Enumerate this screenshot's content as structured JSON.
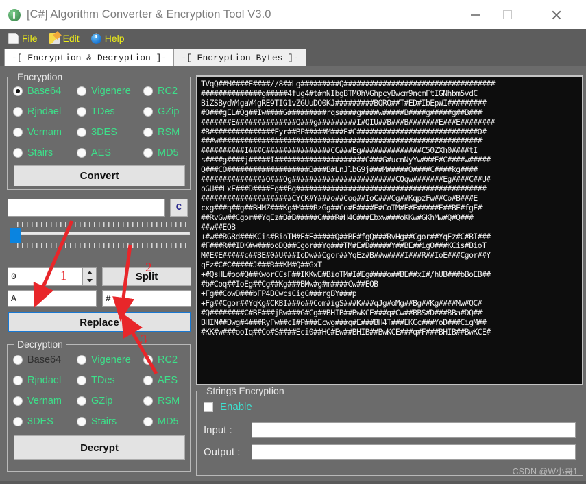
{
  "window": {
    "title": "[C#] Algorithm Converter & Encryption Tool V3.0",
    "app_icon": "app-logo-icon",
    "minimize_label": "–",
    "maximize_label": "□",
    "close_label": "✕"
  },
  "menu": {
    "items": [
      {
        "label": "File",
        "icon": "file-icon"
      },
      {
        "label": "Edit",
        "icon": "pencil-icon"
      },
      {
        "label": "Help",
        "icon": "info-icon"
      }
    ]
  },
  "tabs": [
    {
      "label": "-[ Encryption & Decryption ]-",
      "active": true
    },
    {
      "label": "-[ Encryption Bytes ]-",
      "active": false
    }
  ],
  "encryption": {
    "group_title": "Encryption",
    "options": [
      {
        "label": "Base64",
        "checked": true
      },
      {
        "label": "Vigenere",
        "checked": false
      },
      {
        "label": "RC2",
        "checked": false
      },
      {
        "label": "Rjndael",
        "checked": false
      },
      {
        "label": "TDes",
        "checked": false
      },
      {
        "label": "GZip",
        "checked": false
      },
      {
        "label": "Vernam",
        "checked": false
      },
      {
        "label": "3DES",
        "checked": false
      },
      {
        "label": "RSM",
        "checked": false
      },
      {
        "label": "Stairs",
        "checked": false
      },
      {
        "label": "AES",
        "checked": false
      },
      {
        "label": "MD5",
        "checked": false
      }
    ],
    "convert_label": "Convert"
  },
  "middle": {
    "key_input_value": "",
    "key_input_placeholder": "",
    "clear_button_label": "C",
    "slider_value": 0,
    "spinner_value": "0",
    "split_label": "Split",
    "find_value": "A",
    "replace_value": "#",
    "replace_label": "Replace"
  },
  "decryption": {
    "group_title": "Decryption",
    "options": [
      {
        "label": "Base64",
        "checked": false,
        "dim": true
      },
      {
        "label": "Vigenere",
        "checked": false,
        "dim": false
      },
      {
        "label": "RC2",
        "checked": false,
        "dim": false
      },
      {
        "label": "Rjndael",
        "checked": false,
        "dim": false
      },
      {
        "label": "TDes",
        "checked": false,
        "dim": false
      },
      {
        "label": "AES",
        "checked": false,
        "dim": false
      },
      {
        "label": "Vernam",
        "checked": false,
        "dim": false
      },
      {
        "label": "GZip",
        "checked": false,
        "dim": false
      },
      {
        "label": "RSM",
        "checked": false,
        "dim": false
      },
      {
        "label": "3DES",
        "checked": false,
        "dim": false
      },
      {
        "label": "Stairs",
        "checked": false,
        "dim": false
      },
      {
        "label": "MD5",
        "checked": false,
        "dim": false
      }
    ],
    "decrypt_label": "Decrypt"
  },
  "output": {
    "text": "TVqQ##M####E####//8##Lg#########Q###################################\n##############g#####4fug4#t#nNIbgBTM0hVGhpcyBwcm9ncmFtIGNhbm5vdC\nBiZSBydW4gaW4gRE9TIG1vZGUuDQ0KJ#########BQRQ##T#ED#IbEpWI#########\n#O###gEL#Qg##Iw####G#########rqs####g####w#####B####g#####g##B###\n#######E##############Q###g#########I#QIU##B###B#######E###E########\n#B###############Fyr##BP#####M###E#C############################O#\n###w#############################################################\n##########I###C###############CC###Eg##############C50ZXh0####tI\ns####g####j#####I#####################C###G#ucnNyYw###E#C####w#####\nQ###CO###################B###B#LnJlbG9j###M#####O####C####kg####\n###############Q###Qg########################CQqw#######Eg####C##U#\noGU##LxF###D####Eg##Bg############################################\n#####################CYCK#Y###o##Coq##IoC###Cg##KqpzFw##Co#B###E\ncxg###q##g##BHMZ###Kg#M###RzGg##Co#E####E#CoTM#E#E#####E##BE#fgE#\n##RvGw##Cgor##YqEz#B#B#####C###R#H4C###Ebxw###oKKw#GKhMw#Q#Q###\n##w##EQB\n+#w##BG8d###KCis#BioTM#E#E#####Q##BE#fgQ###RvHg##Cgor##YqEz#C#BI###\n#F###R##IDK#w###ooDQ##Cgor##Yq###TM#E#D#####Y##BE##igO###KCis#BioT\nM#E#E#####c##BE#0#U###IoDw##Cgor##YqEz#B##w####I###R##IoE###Cgor##Y\nqEz#C#C#####J###R##KM#Q##GxT\n+#QsHL#oo#Q##KworCCsF##IKKwE#BioTM#I#Eg####o##BE##xI#/hUB###bBoEB##\n#b#Coq##IoEg##Cg##Kg###BMw#g#m####Cw##EQB\n+Fg##CowD###bFP4BCwcsCigC###rgBY###p\n+Fg##Cgor##YqKg#CKBI###o##Com#igS###K###qJg#oMg##Bg##Kg####Mw#QC#\n#Q########C#BF###jRw###G#Cg##BHIB##BwKCE###q#Cw##BBS#D###BBa#DQ##\nBHIN##Bwg#4###RyFw##cI#P###Ecwg###q#E###BH4T###EKCc###YoD###CigM##\n#KK#w###ooIq##Co#S####Eci0##HC#Ew##BHIB##BwKCE###q#F###BHIB##BwKCE#"
  },
  "strings_encryption": {
    "group_title": "Strings Encryption",
    "enable_label": "Enable",
    "enable_checked": false,
    "input_label": "Input :",
    "input_value": "",
    "output_label": "Output :",
    "output_value": ""
  },
  "annotations": {
    "markers": [
      "1",
      "2",
      "3"
    ],
    "color": "#e8262a"
  },
  "watermark": {
    "text": "CSDN @W小哥1"
  },
  "colors": {
    "window_bg": "#6b6b6b",
    "menu_bg": "#5d5d5d",
    "menu_text": "#eded18",
    "radio_text": "#3de08a",
    "accent_blue": "#1878d2",
    "slider_thumb": "#0a84e0",
    "console_bg": "#0d0d0d",
    "console_text": "#f2f2f2",
    "annotation_red": "#e8262a"
  }
}
